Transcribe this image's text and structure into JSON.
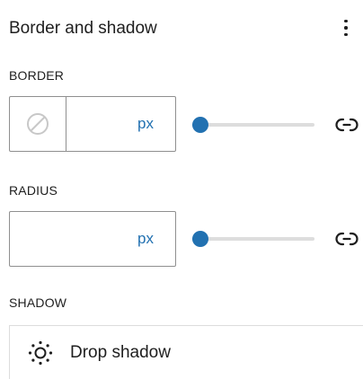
{
  "panel": {
    "title": "Border and shadow"
  },
  "border": {
    "label": "BORDER",
    "value": "",
    "unit": "px",
    "slider_value": 0
  },
  "radius": {
    "label": "RADIUS",
    "value": "",
    "unit": "px",
    "slider_value": 0
  },
  "shadow": {
    "label": "SHADOW",
    "item_label": "Drop shadow"
  },
  "icons": {
    "more": "more-vertical-icon",
    "color": "no-color-icon",
    "link": "link-icon",
    "shadow": "shadow-sun-icon"
  },
  "colors": {
    "accent": "#2271b1",
    "border": "#8f8f8f",
    "track": "#dddddd",
    "text": "#1e1e1e"
  }
}
